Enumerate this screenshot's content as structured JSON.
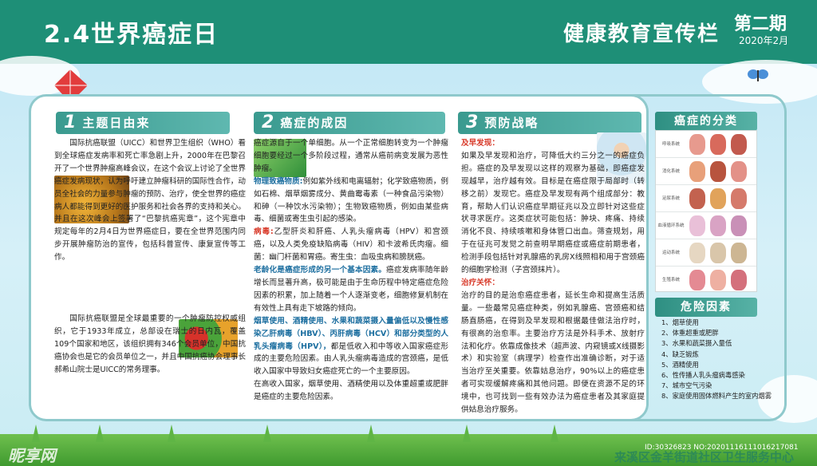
{
  "header": {
    "title": "2.4世界癌症日",
    "slogan": "健康教育宣传栏",
    "issue": "第二期",
    "date": "2020年2月"
  },
  "sections": [
    {
      "num": "1",
      "label": "主题日由来",
      "p1": "国际抗癌联盟（UICC）和世界卫生组织（WHO）看到全球癌症发病率和死亡率急剧上升，2000年在巴黎召开了一个世界肿瘤高峰会议，在这个会议上讨论了全世界癌症发病现状，认为呼吁建立肿瘤科研的国际性合作，动员全社会的力量参与肿瘤的预防、治疗，使全世界的癌症病人都能得到更好的医护服务和社会各界的支持和关心。并且在这次峰会上签署了“巴黎抗癌宪章”，这个宪章中规定每年的2月4日为世界癌症日，要在全世界范围内同步开展肿瘤防治的宣传，包括科普宣传、康复宣传等工作。",
      "p2": "国际抗癌联盟是全球最重要的一个肿瘤防控权威组织，它于1933年成立，总部设在瑞士的日内瓦，覆盖109个国家和地区，该组织拥有346个会员单位，中国抗癌协会也是它的会员单位之一，并且中国抗癌协会理事长郝希山院士是UICC的常务理事。"
    },
    {
      "num": "2",
      "label": "癌症的成因",
      "intro": "癌症源自于一个单细胞。从一个正常细胞转变为一个肿瘤细胞要经过一个多阶段过程，通常从癌前病变发展为恶性肿瘤。",
      "physical_title": "物理致癌物质:",
      "physical": "例如紫外线和电离辐射；化学致癌物质，例如石棉、烟草烟雾成分、黄曲霉毒素（一种食品污染物）和砷（一种饮水污染物）；生物致癌物质，例如由某些病毒、细菌或寄生虫引起的感染。",
      "virus_title": "病毒:",
      "virus": "乙型肝炎和肝癌、人乳头瘤病毒（HPV）和宫颈癌，以及人类免疫缺陷病毒（HIV）和卡波希氏肉瘤。细菌：幽门杆菌和胃癌。寄生虫：血吸虫病和膀胱癌。",
      "aging_title": "老龄化是癌症形成的另一个基本因素。",
      "aging": "癌症发病率随年龄增长而显著升高，极可能是由于生命历程中特定癌症危险因素的积累，加上随着一个人逐渐变老，细胞修复机制在有效性上具有走下坡路的倾向。",
      "tobacco_title": "烟草使用、酒精使用、水果和蔬菜摄入量偏低以及慢性感染乙肝病毒（HBV）、丙肝病毒（HCV）和部分类型的人乳头瘤病毒（HPV），",
      "tobacco": "都是低收入和中等收入国家癌症形成的主要危险因素。由人乳头瘤病毒造成的宫颈癌，是低收入国家中导致妇女癌症死亡的一个主要原因。",
      "tail": "在高收入国家，烟草使用、酒精使用以及体重超重或肥胖是癌症的主要危险因素。"
    },
    {
      "num": "3",
      "label": "预防战略",
      "early_title": "及早发现：",
      "early": "如果及早发现和治疗，可降低大约三分之一的癌症负担。癌症的及早发现以这样的观察为基础，即癌症发现越早，治疗越有效。目标是在癌症限于局部时（转移之前）发现它。癌症及早发现有两个组成部分：教育，帮助人们认识癌症早期征兆以及立即针对这些症状寻求医疗。这类症状可能包括：肿块、疼痛、持续消化不良、持续咳嗽和身体管口出血。筛查规划，用于在征兆可发觉之前查明早期癌症或癌症前期患者，检测手段包括针对乳腺癌的乳房X线照相和用于宫颈癌的细胞学检测（子宫颈抹片）。",
      "treat_title": "治疗关怀：",
      "treat": "治疗的目的是治愈癌症患者，延长生命和提高生活质量。一些最常见癌症种类，例如乳腺癌、宫颈癌和结肠直肠癌，在得到及早发现和根据最佳做法治疗时，有很高的治愈率。主要治疗方法是外科手术、放射疗法和化疗。依靠成像技术（超声波、内窥镜或X线摄影术）和实验室（病理学）检查作出准确诊断，对于适当治疗至关重要。依靠姑息治疗，90%以上的癌症患者可实现缓解疼痛和其他问题。即便在资源不足的环境中，也可找到一些有效办法为癌症患者及其家庭提供姑息治疗服务。"
    }
  ],
  "sidebar": {
    "cat_title": "癌症的分类",
    "rows": [
      "呼吸系统",
      "消化系统",
      "泌尿系统",
      "血液循环系统",
      "运动系统",
      "生殖系统"
    ],
    "risk_title": "危险因素",
    "risks": [
      "1、烟草使用",
      "2、体重超重或肥胖",
      "3、水果和蔬菜摄入量低",
      "4、缺乏锻炼",
      "5、酒精使用",
      "6、性传播人乳头瘤病毒感染",
      "7、城市空气污染",
      "8、家庭使用固体燃料产生的室内烟雾"
    ]
  },
  "footer": {
    "org": "来溪区金羊街道社区卫生服务中心",
    "watermark": "昵享网",
    "id": "ID:30326823 NO:20201116111016217081"
  },
  "colors": {
    "header": "#1e8f77",
    "accent": "#3a9a8f",
    "highlight": "#1d6fa0",
    "red": "#d83a2a"
  }
}
